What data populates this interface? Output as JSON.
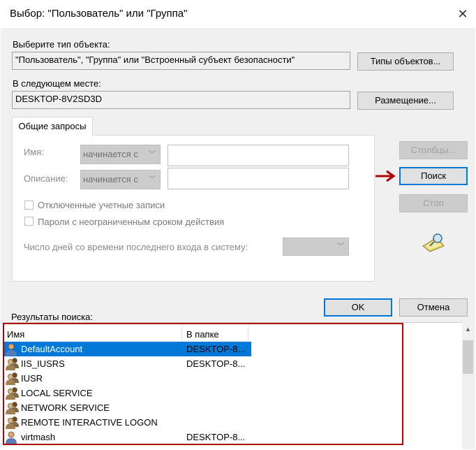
{
  "window": {
    "title": "Выбор: \"Пользователь\" или \"Группа\"",
    "close_glyph": "✕"
  },
  "object_type": {
    "label": "Выберите тип объекта:",
    "value": "\"Пользователь\", \"Группа\" или \"Встроенный субъект безопасности\"",
    "button": "Типы объектов..."
  },
  "location": {
    "label": "В следующем месте:",
    "value": "DESKTOP-8V2SD3D",
    "button": "Размещение..."
  },
  "tab": {
    "label": "Общие запросы"
  },
  "query": {
    "name_label": "Имя:",
    "name_mode": "начинается с",
    "desc_label": "Описание:",
    "desc_mode": "начинается с",
    "disabled_accounts": "Отключенные учетные записи",
    "non_expiring": "Пароли с неограниченным сроком действия",
    "days_label": "Число дней со времени последнего входа в систему:"
  },
  "buttons": {
    "columns": "Столбцы...",
    "search": "Поиск",
    "stop": "Стоп",
    "ok": "OK",
    "cancel": "Отмена"
  },
  "results": {
    "label": "Результаты поиска:",
    "columns": [
      "Имя",
      "В папке"
    ],
    "rows": [
      {
        "name": "DefaultAccount",
        "folder": "DESKTOP-8...",
        "icon": "user-icon",
        "selected": true
      },
      {
        "name": "IIS_IUSRS",
        "folder": "DESKTOP-8...",
        "icon": "group-icon",
        "selected": false
      },
      {
        "name": "IUSR",
        "folder": "",
        "icon": "group-icon",
        "selected": false
      },
      {
        "name": "LOCAL SERVICE",
        "folder": "",
        "icon": "group-icon",
        "selected": false
      },
      {
        "name": "NETWORK SERVICE",
        "folder": "",
        "icon": "group-icon",
        "selected": false
      },
      {
        "name": "REMOTE INTERACTIVE LOGON",
        "folder": "",
        "icon": "group-icon",
        "selected": false
      },
      {
        "name": "virtmash",
        "folder": "DESKTOP-8...",
        "icon": "user-icon",
        "selected": false
      }
    ]
  },
  "colors": {
    "accent": "#0078d7",
    "annotation": "#b00000"
  }
}
